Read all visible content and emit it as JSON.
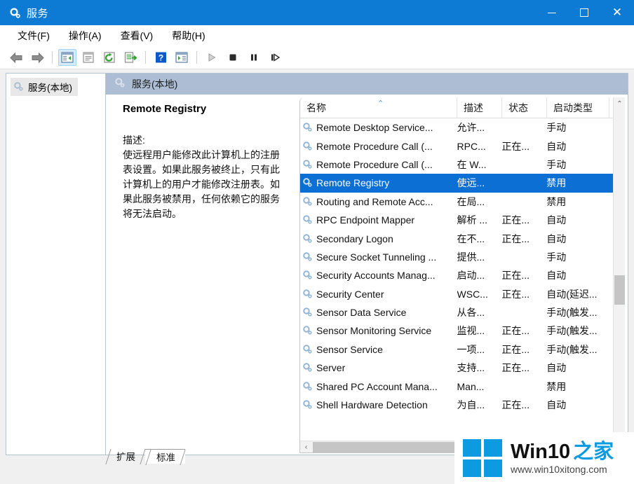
{
  "window": {
    "title": "服务",
    "icon": "gear-icon",
    "controls": {
      "minimize": "–",
      "maximize": "□",
      "close": "✕"
    },
    "accent_color": "#0d7ad4"
  },
  "menu": {
    "items": [
      {
        "label": "文件(F)"
      },
      {
        "label": "操作(A)"
      },
      {
        "label": "查看(V)"
      },
      {
        "label": "帮助(H)"
      }
    ]
  },
  "toolbar": {
    "buttons": [
      {
        "name": "back",
        "icon": "arrow-left-icon"
      },
      {
        "name": "forward",
        "icon": "arrow-right-icon"
      },
      {
        "name": "show-hide-console-tree",
        "icon": "console-tree-icon",
        "active": true
      },
      {
        "name": "properties",
        "icon": "properties-icon"
      },
      {
        "name": "refresh",
        "icon": "refresh-icon"
      },
      {
        "name": "export-list",
        "icon": "export-list-icon"
      },
      {
        "name": "help",
        "icon": "help-icon"
      },
      {
        "name": "show-action-pane",
        "icon": "action-pane-icon"
      },
      {
        "name": "start-service",
        "icon": "play-icon"
      },
      {
        "name": "stop-service",
        "icon": "stop-icon"
      },
      {
        "name": "pause-service",
        "icon": "pause-icon"
      },
      {
        "name": "restart-service",
        "icon": "restart-icon"
      }
    ]
  },
  "tree": {
    "root_label": "服务(本地)"
  },
  "content": {
    "header_label": "服务(本地)",
    "selected_service_title": "Remote Registry",
    "description_label": "描述:",
    "description_text": "使远程用户能修改此计算机上的注册表设置。如果此服务被终止，只有此计算机上的用户才能修改注册表。如果此服务被禁用，任何依赖它的服务将无法启动。"
  },
  "list": {
    "columns": [
      {
        "key": "name",
        "label": "名称",
        "sorted": "asc",
        "sort_glyph": "⌃"
      },
      {
        "key": "desc",
        "label": "描述"
      },
      {
        "key": "state",
        "label": "状态"
      },
      {
        "key": "start",
        "label": "启动类型"
      }
    ],
    "rows": [
      {
        "name": "Remote Desktop Service...",
        "desc": "允许...",
        "state": "",
        "start": "手动",
        "selected": false
      },
      {
        "name": "Remote Procedure Call (...",
        "desc": "RPC...",
        "state": "正在...",
        "start": "自动",
        "selected": false
      },
      {
        "name": "Remote Procedure Call (...",
        "desc": "在 W...",
        "state": "",
        "start": "手动",
        "selected": false
      },
      {
        "name": "Remote Registry",
        "desc": "使远...",
        "state": "",
        "start": "禁用",
        "selected": true
      },
      {
        "name": "Routing and Remote Acc...",
        "desc": "在局...",
        "state": "",
        "start": "禁用",
        "selected": false
      },
      {
        "name": "RPC Endpoint Mapper",
        "desc": "解析 ...",
        "state": "正在...",
        "start": "自动",
        "selected": false
      },
      {
        "name": "Secondary Logon",
        "desc": "在不...",
        "state": "正在...",
        "start": "自动",
        "selected": false
      },
      {
        "name": "Secure Socket Tunneling ...",
        "desc": "提供...",
        "state": "",
        "start": "手动",
        "selected": false
      },
      {
        "name": "Security Accounts Manag...",
        "desc": "启动...",
        "state": "正在...",
        "start": "自动",
        "selected": false
      },
      {
        "name": "Security Center",
        "desc": "WSC...",
        "state": "正在...",
        "start": "自动(延迟...",
        "selected": false
      },
      {
        "name": "Sensor Data Service",
        "desc": "从各...",
        "state": "",
        "start": "手动(触发...",
        "selected": false
      },
      {
        "name": "Sensor Monitoring Service",
        "desc": "监视...",
        "state": "正在...",
        "start": "手动(触发...",
        "selected": false
      },
      {
        "name": "Sensor Service",
        "desc": "一项...",
        "state": "正在...",
        "start": "手动(触发...",
        "selected": false
      },
      {
        "name": "Server",
        "desc": "支持...",
        "state": "正在...",
        "start": "自动",
        "selected": false
      },
      {
        "name": "Shared PC Account Mana...",
        "desc": "Man...",
        "state": "",
        "start": "禁用",
        "selected": false
      },
      {
        "name": "Shell Hardware Detection",
        "desc": "为自...",
        "state": "正在...",
        "start": "自动",
        "selected": false
      }
    ],
    "scroll_up_glyph": "⌃",
    "scroll_down_glyph": "⌄",
    "scroll_left_glyph": "‹",
    "selection_color": "#0c6fd4"
  },
  "tabs": [
    {
      "label": "扩展",
      "selected": false
    },
    {
      "label": "标准",
      "selected": true
    }
  ],
  "watermark": {
    "brand": "Win10",
    "brand_cn": "之家",
    "url": "www.win10xitong.com",
    "logo_color": "#0c9ae0"
  }
}
